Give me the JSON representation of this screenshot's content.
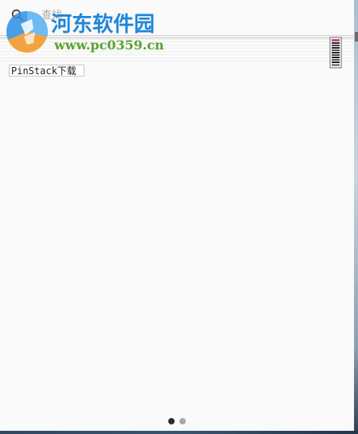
{
  "search": {
    "placeholder": "查找",
    "icon": "search-icon"
  },
  "watermark": {
    "title": "河东软件园",
    "url": "www.pc0359.cn",
    "logo_icon": "pc0359-logo-icon",
    "colors": {
      "title": "#1f86d8",
      "url": "#5aa32f",
      "logo_orange": "#f29a2e",
      "logo_blue": "#2b8ee0"
    }
  },
  "top_right": {
    "icon": "app-widget-icon"
  },
  "app_tiles": [
    {
      "label": "PinStack下载"
    }
  ],
  "pagination": {
    "pages": 2,
    "current": 1
  }
}
